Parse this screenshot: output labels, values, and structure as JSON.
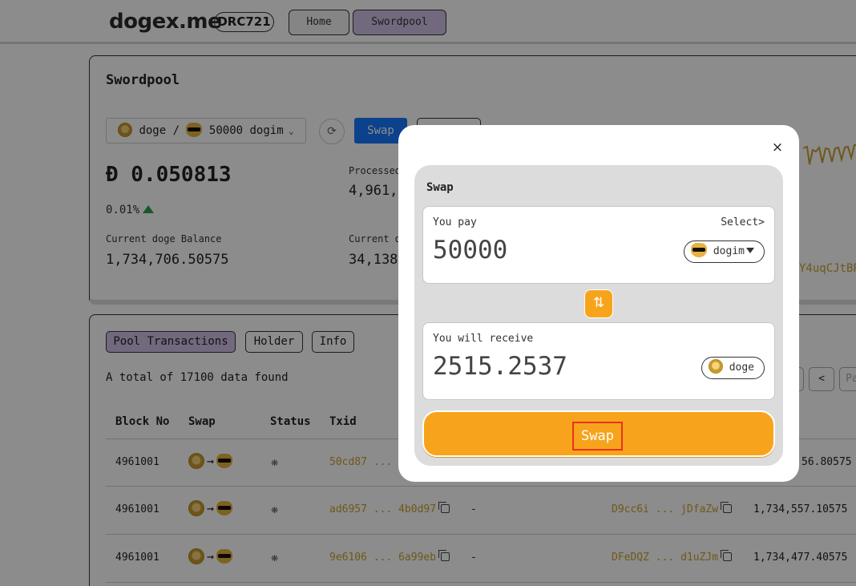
{
  "header": {
    "logo": "dogex.me",
    "badge": "DRC721",
    "nav": [
      "Home",
      "Swordpool"
    ]
  },
  "pool": {
    "title": "Swordpool",
    "pair": {
      "base": "doge",
      "separator": "/",
      "quote": "50000 dogim"
    },
    "swap_button": "Swap",
    "price": "Đ 0.050813",
    "change": "0.01%",
    "processed_label": "Processed",
    "processed_value": "4,961,",
    "doge_balance_label": "Current doge Balance",
    "doge_balance_value": "1,734,706.50575",
    "current_label": "Current d",
    "current_value": "34,138",
    "address_fragment": "Y4uqCJtBP"
  },
  "transactions": {
    "tabs": [
      "Pool Transactions",
      "Holder",
      "Info"
    ],
    "total_text": "A total of 17100 data found",
    "pager": [
      "<",
      "Pa"
    ],
    "columns": [
      "Block No",
      "Swap",
      "Status",
      "Txid"
    ],
    "rows": [
      {
        "block": "4961001",
        "txid": "50cd87 ... c",
        "dash": "",
        "address": "",
        "balance": "56.80575"
      },
      {
        "block": "4961001",
        "txid": "ad6957 ... 4b0d97",
        "dash": "-",
        "address": "D9cc6i ... jDfaZw",
        "balance": "1,734,557.10575"
      },
      {
        "block": "4961001",
        "txid": "9e6106 ... 6a99eb",
        "dash": "-",
        "address": "DFeDQZ ... d1uZJm",
        "balance": "1,734,477.40575"
      }
    ]
  },
  "modal": {
    "close": "×",
    "title": "Swap",
    "pay": {
      "label": "You pay",
      "select": "Select>",
      "amount": "50000",
      "token": "dogim"
    },
    "receive": {
      "label": "You will receive",
      "amount": "2515.2537",
      "token": "doge"
    },
    "swap_button": "Swap",
    "colors": {
      "accent": "#f7a41c",
      "highlight": "#e8331d",
      "link": "#c8a02e"
    }
  }
}
